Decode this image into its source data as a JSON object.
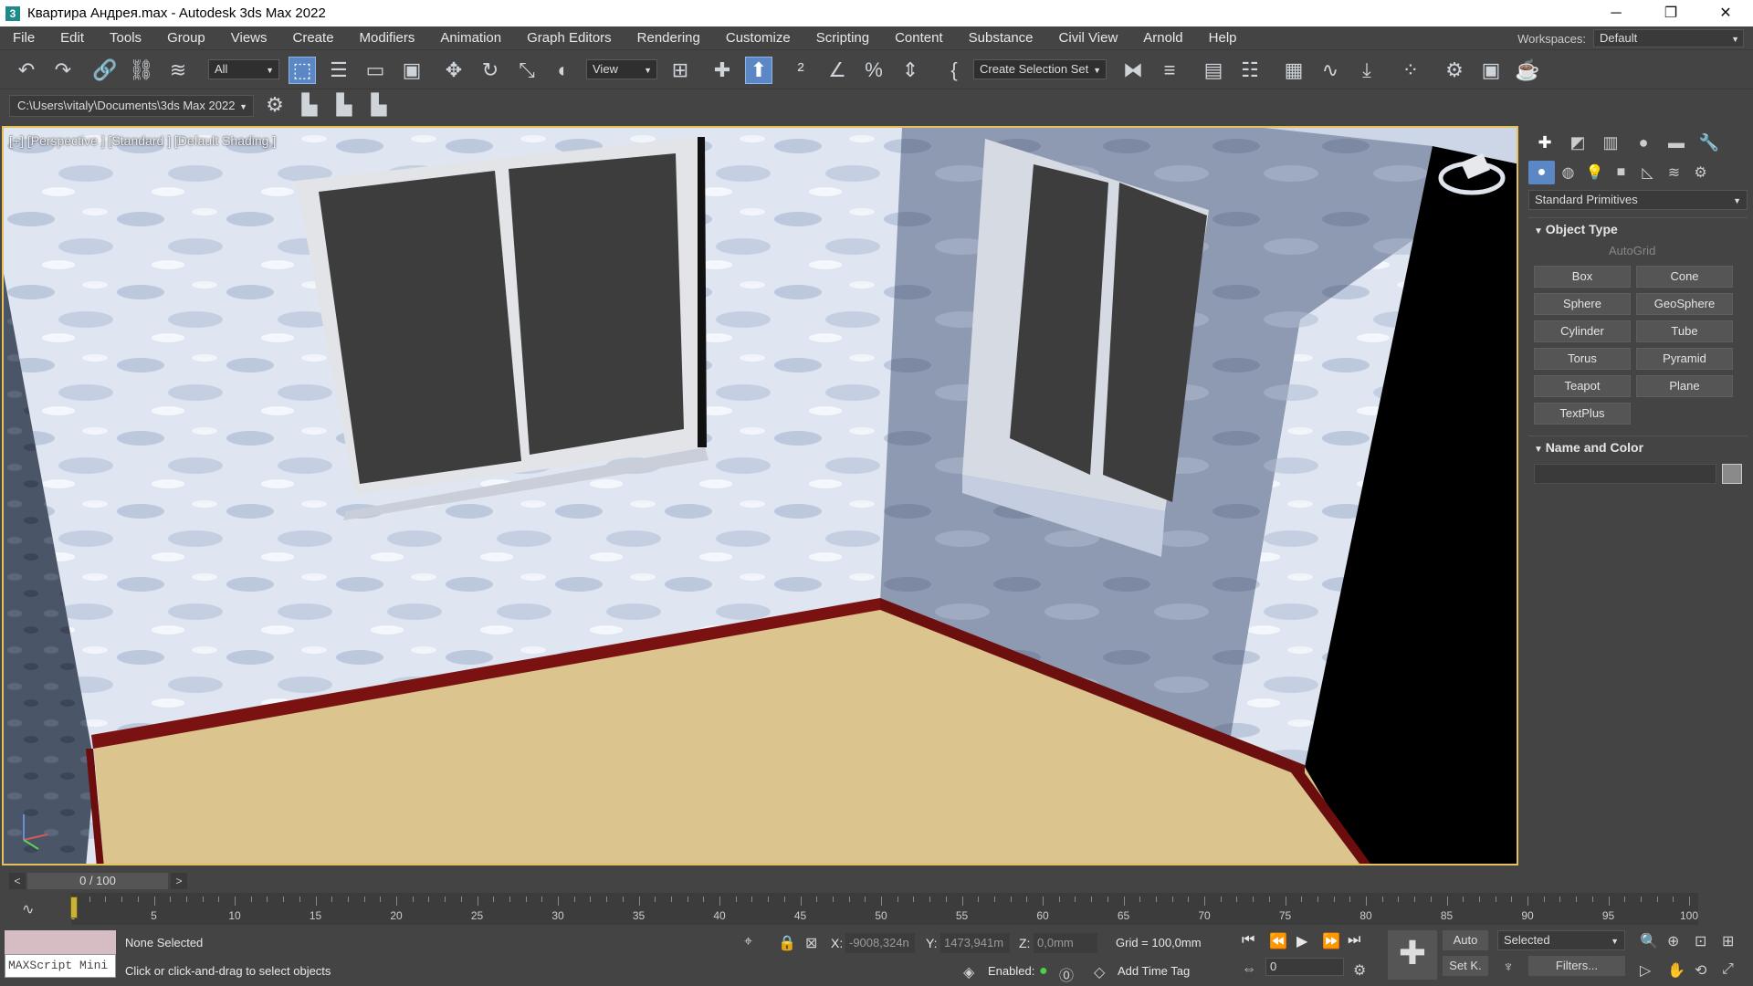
{
  "window": {
    "title": "Квартира Андрея.max - Autodesk 3ds Max 2022",
    "app_icon": "3",
    "controls": [
      "─",
      "❐",
      "✕"
    ]
  },
  "menu": [
    "File",
    "Edit",
    "Tools",
    "Group",
    "Views",
    "Create",
    "Modifiers",
    "Animation",
    "Graph Editors",
    "Rendering",
    "Customize",
    "Scripting",
    "Content",
    "Substance",
    "Civil View",
    "Arnold",
    "Help"
  ],
  "workspaces": {
    "label": "Workspaces:",
    "value": "Default"
  },
  "toolbar": {
    "filter": "All",
    "ref_coord": "View",
    "selection_set": "Create Selection Set"
  },
  "project": {
    "path": "C:\\Users\\vitaly\\Documents\\3ds Max 2022"
  },
  "viewport": {
    "label": "[+] [Perspective ] [Standard ] [Default Shading ]"
  },
  "command_panel": {
    "category": "Standard Primitives",
    "object_type": {
      "header": "Object Type",
      "autogrid": "AutoGrid",
      "buttons": [
        "Box",
        "Cone",
        "Sphere",
        "GeoSphere",
        "Cylinder",
        "Tube",
        "Torus",
        "Pyramid",
        "Teapot",
        "Plane",
        "TextPlus"
      ]
    },
    "name_color": {
      "header": "Name and Color",
      "swatch": "#8a8a8a"
    }
  },
  "timeslider": {
    "value": "0 / 100",
    "prev": "<",
    "next": ">"
  },
  "timeline": {
    "ticks": [
      "0",
      "5",
      "10",
      "15",
      "20",
      "25",
      "30",
      "35",
      "40",
      "45",
      "50",
      "55",
      "60",
      "65",
      "70",
      "75",
      "80",
      "85",
      "90",
      "95",
      "100"
    ]
  },
  "status": {
    "maxscript": "MAXScript Mini",
    "selection": "None Selected",
    "prompt": "Click or click-and-drag to select objects",
    "x_label": "X:",
    "x_value": "-9008,324n",
    "y_label": "Y:",
    "y_value": "1473,941m",
    "z_label": "Z:",
    "z_value": "0,0mm",
    "grid": "Grid = 100,0mm",
    "enabled": "Enabled:",
    "add_time_tag": "Add Time Tag",
    "auto": "Auto",
    "set_key": "Set K.",
    "selected": "Selected",
    "filters": "Filters...",
    "frame": "0"
  }
}
